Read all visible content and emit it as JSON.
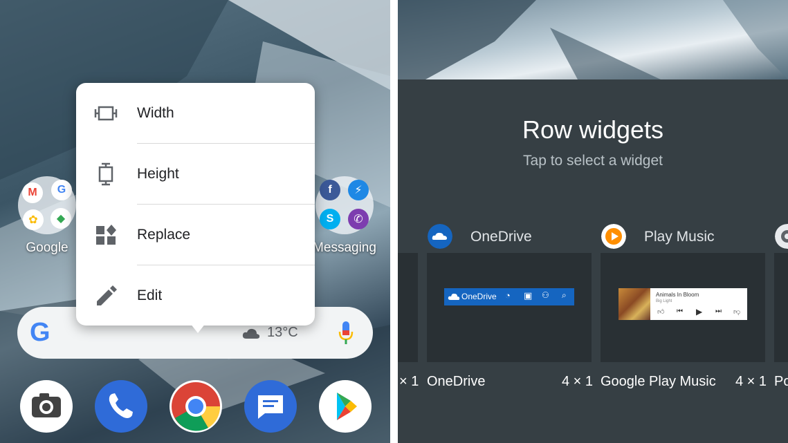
{
  "home": {
    "folders": [
      {
        "label": "Google"
      },
      {
        "label": "Messaging"
      }
    ],
    "search_bar": {
      "temperature": "13°C"
    },
    "popup_menu": {
      "items": [
        {
          "label": "Width",
          "icon": "width-icon"
        },
        {
          "label": "Height",
          "icon": "height-icon"
        },
        {
          "label": "Replace",
          "icon": "replace-icon"
        },
        {
          "label": "Edit",
          "icon": "edit-icon"
        }
      ]
    },
    "dock": [
      "camera-icon",
      "phone-icon",
      "chrome-icon",
      "messages-icon",
      "play-store-icon"
    ]
  },
  "widget_picker": {
    "title": "Row widgets",
    "subtitle": "Tap to select a widget",
    "left_partial_size": "× 1",
    "right_partial_name": "Po",
    "cards": [
      {
        "app": "OneDrive",
        "widget_name": "OneDrive",
        "size": "4 × 1",
        "preview_label": "OneDrive"
      },
      {
        "app": "Play Music",
        "widget_name": "Google Play Music",
        "size": "4 × 1",
        "preview_title": "Animals In Bloom",
        "preview_artist": "Big Light"
      }
    ]
  },
  "colors": {
    "onedrive_blue": "#1565c0",
    "play_music_orange": "#ff8f00",
    "sheet_bg": "#363f44",
    "google_blue": "#4285f4",
    "google_red": "#ea4335",
    "google_yellow": "#fbbc05",
    "google_green": "#34a853"
  }
}
